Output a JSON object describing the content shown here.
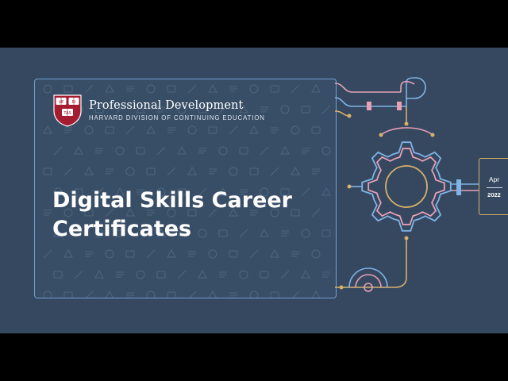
{
  "brand": {
    "title": "Professional Development",
    "subtitle": "HARVARD DIVISION OF CONTINUING EDUCATION",
    "shield_text": [
      "VE",
      "RI",
      "TAS"
    ]
  },
  "slide": {
    "title_line1": "Digital Skills Career",
    "title_line2": "Certificates"
  },
  "date": {
    "month": "Apr",
    "year": "2022"
  },
  "colors": {
    "background": "#354860",
    "card_border": "#6fa0d4",
    "accent_pink": "#e7a0b8",
    "accent_blue": "#7fb4e6",
    "accent_gold": "#d7b16a",
    "shield_red": "#a51c30"
  }
}
